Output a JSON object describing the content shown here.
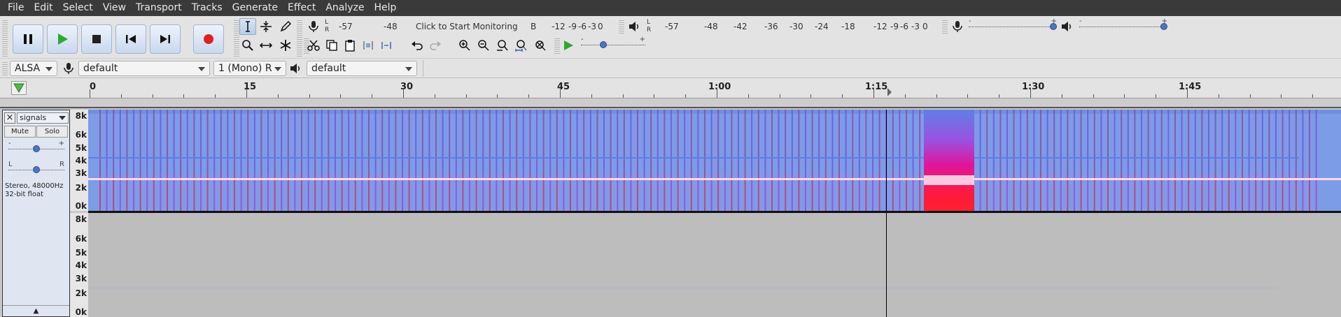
{
  "menu": [
    "File",
    "Edit",
    "Select",
    "View",
    "Transport",
    "Tracks",
    "Generate",
    "Effect",
    "Analyze",
    "Help"
  ],
  "record_meter": {
    "lr_top": "L",
    "lr_bottom": "R",
    "ticks": [
      "-57",
      "-48",
      "Click to Start Monitoring",
      "-12",
      "-9",
      "-6",
      "-3",
      "0"
    ],
    "tick_b": "B"
  },
  "playback_meter": {
    "lr_top": "L",
    "lr_bottom": "R",
    "ticks": [
      "-57",
      "-48",
      "-42",
      "-36",
      "-30",
      "-24",
      "-18",
      "-12",
      "-9",
      "-6",
      "-3",
      "0"
    ]
  },
  "mixer": {
    "minus": "-",
    "plus": "+"
  },
  "play_at_speed": {
    "minus": "-",
    "plus": "+"
  },
  "devices": {
    "host": "ALSA",
    "recording_device": "default",
    "channels": "1 (Mono) R",
    "playback_device": "default"
  },
  "ruler": {
    "labels": [
      "0",
      "15",
      "30",
      "45",
      "1:00",
      "1:15",
      "1:30",
      "1:45"
    ]
  },
  "track": {
    "name": "signals",
    "mute_label": "Mute",
    "solo_label": "Solo",
    "gain_minus": "-",
    "gain_plus": "+",
    "pan_left": "L",
    "pan_right": "R",
    "info_line1": "Stereo, 48000Hz",
    "info_line2": "32-bit float",
    "close_glyph": "×",
    "collapse_glyph": "▲"
  },
  "freq_labels": [
    "8k",
    "6k",
    "5k",
    "4k",
    "3k",
    "2k",
    "0k"
  ],
  "colors": {
    "menubar": "#3a3a3a",
    "spectrogram_bg": "#7fa0e8",
    "burst": "#e0156e",
    "selection_cursor": "#000000",
    "empty_channel": "#bcbcbc"
  }
}
